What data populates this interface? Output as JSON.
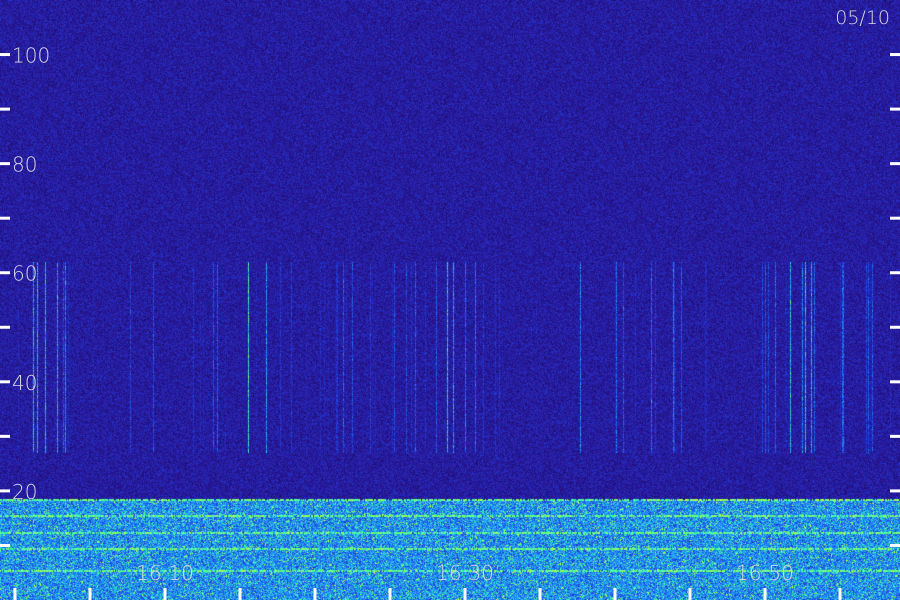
{
  "chart_data": {
    "type": "heatmap",
    "title": "",
    "date_label": "05/10",
    "xlabel": "",
    "ylabel": "",
    "y_ticks": [
      {
        "value": 20,
        "label": "20"
      },
      {
        "value": 40,
        "label": "40"
      },
      {
        "value": 60,
        "label": "60"
      },
      {
        "value": 80,
        "label": "80"
      },
      {
        "value": 100,
        "label": "100"
      }
    ],
    "y_minor_ticks": [
      10,
      30,
      50,
      70,
      90
    ],
    "ylim": [
      0,
      110
    ],
    "x_ticks": [
      {
        "value": 10,
        "label": "16:10"
      },
      {
        "value": 30,
        "label": "16:30"
      },
      {
        "value": 50,
        "label": "16:50"
      }
    ],
    "x_minor_ticks": [
      0,
      5,
      15,
      20,
      25,
      35,
      40,
      45,
      55
    ],
    "xlim": [
      -1,
      59
    ],
    "colormap": [
      "#000000",
      "#1a0860",
      "#2a1aa0",
      "#2040e0",
      "#20a0ff",
      "#40ffa0",
      "#c0ff40"
    ],
    "axis_color": "#ffffff",
    "grid": false
  }
}
